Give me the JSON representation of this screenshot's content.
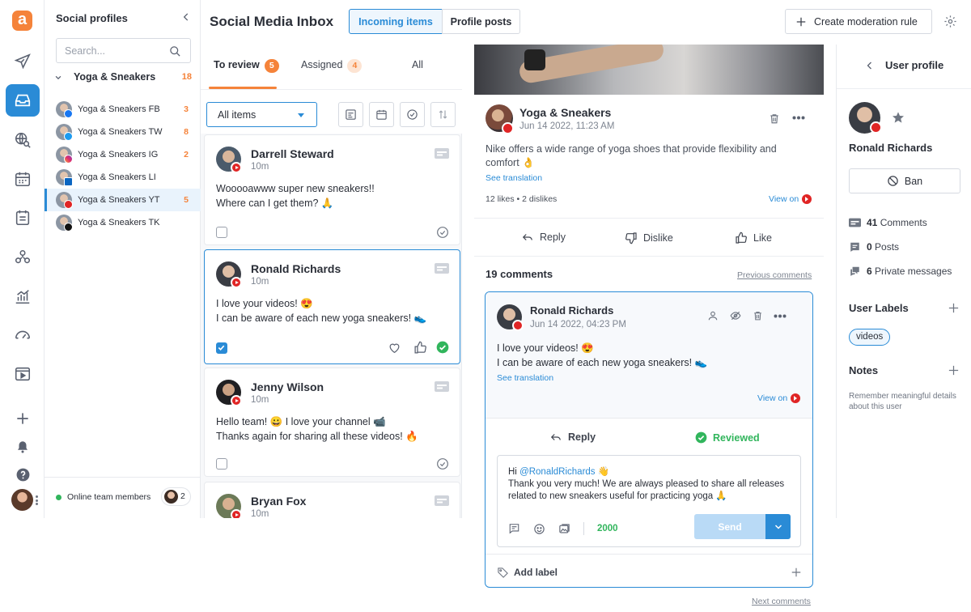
{
  "app": {
    "logo_letter": "a",
    "page_title": "Social Media Inbox",
    "header_tabs": [
      "Incoming items",
      "Profile posts"
    ],
    "create_rule_label": "Create moderation rule"
  },
  "rail": {
    "icons": [
      "send-icon",
      "inbox-icon",
      "globe-search-icon",
      "calendar-icon",
      "report-icon",
      "team-icon",
      "analytics-icon",
      "dashboard-icon",
      "video-icon",
      "plus-icon",
      "bell-icon",
      "help-icon"
    ],
    "active": "inbox-icon"
  },
  "profiles": {
    "title": "Social profiles",
    "search_placeholder": "Search...",
    "group": {
      "name": "Yoga & Sneakers",
      "count": "18"
    },
    "items": [
      {
        "name": "Yoga & Sneakers FB",
        "count": "3",
        "network": "facebook"
      },
      {
        "name": "Yoga & Sneakers TW",
        "count": "8",
        "network": "twitter"
      },
      {
        "name": "Yoga & Sneakers IG",
        "count": "2",
        "network": "instagram"
      },
      {
        "name": "Yoga & Sneakers LI",
        "count": "",
        "network": "linkedin"
      },
      {
        "name": "Yoga & Sneakers YT",
        "count": "5",
        "network": "youtube"
      },
      {
        "name": "Yoga & Sneakers TK",
        "count": "",
        "network": "tiktok"
      }
    ],
    "online_label": "Online team members",
    "online_count": "2"
  },
  "inbox": {
    "tabs": [
      {
        "label": "To review",
        "badge": "5"
      },
      {
        "label": "Assigned",
        "badge": "4"
      },
      {
        "label": "All",
        "badge": ""
      }
    ],
    "filter_value": "All items",
    "cards": [
      {
        "name": "Darrell Steward",
        "time": "10m",
        "line1": "Wooooawww super new sneakers!!",
        "line2": "Where can I get them? 🙏",
        "checked": false
      },
      {
        "name": "Ronald Richards",
        "time": "10m",
        "line1": "I love your videos! 😍",
        "line2": "I can be aware of each new yoga sneakers! 👟",
        "checked": true
      },
      {
        "name": "Jenny Wilson",
        "time": "10m",
        "line1": "Hello team! 😀 I love your channel 📹",
        "line2": "Thanks again for sharing all these videos! 🔥",
        "checked": false
      },
      {
        "name": "Bryan Fox",
        "time": "10m",
        "line1": "",
        "line2": "",
        "checked": false
      }
    ]
  },
  "post": {
    "author": "Yoga & Sneakers",
    "date": "Jun 14 2022, 11:23 AM",
    "text": "Nike offers a wide range of yoga shoes that provide flexibility and comfort 👌",
    "see_translation": "See translation",
    "stats": "12 likes  •  2 dislikes",
    "view_on": "View on",
    "actions": [
      "Reply",
      "Dislike",
      "Like"
    ],
    "comments_title": "19 comments",
    "previous_comments": "Previous comments",
    "next_comments": "Next comments"
  },
  "comment": {
    "author": "Ronald Richards",
    "date": "Jun 14 2022, 04:23 PM",
    "line1": "I love your videos! 😍",
    "line2": "I can be aware of each new yoga sneakers! 👟",
    "see_translation": "See translation",
    "view_on": "View on",
    "reply_label": "Reply",
    "reviewed_label": "Reviewed",
    "reply_greeting": "Hi ",
    "reply_mention": "@RonaldRichards",
    "reply_greeting_end": " 👋",
    "reply_body": "Thank you very much! We are always pleased to share all releases related to new sneakers useful for practicing yoga 🙏",
    "char_count": "2000",
    "send_label": "Send",
    "add_label": "Add label"
  },
  "user_profile": {
    "title": "User profile",
    "name": "Ronald Richards",
    "ban_label": "Ban",
    "stats": [
      {
        "count": "41",
        "label": "Comments"
      },
      {
        "count": "0",
        "label": "Posts"
      },
      {
        "count": "6",
        "label": "Private messages"
      }
    ],
    "labels_title": "User Labels",
    "labels": [
      "videos"
    ],
    "notes_title": "Notes",
    "notes_placeholder": "Remember meaningful details about this user"
  },
  "colors": {
    "accent": "#2a8bd6",
    "brand_orange": "#f5833a",
    "success": "#31b55c",
    "youtube": "#e02525"
  }
}
